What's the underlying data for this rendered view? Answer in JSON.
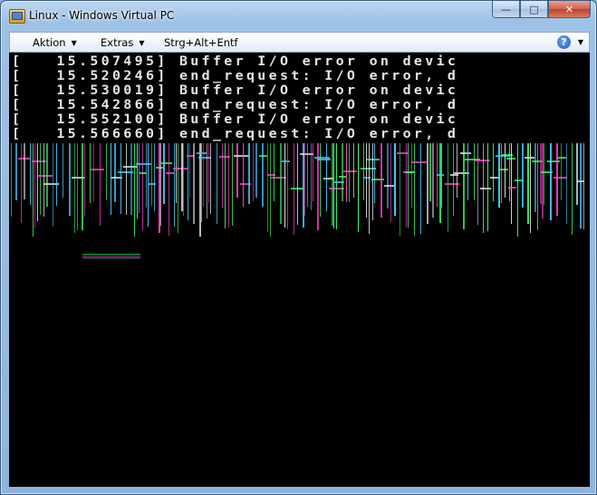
{
  "window": {
    "title": "Linux - Windows Virtual PC",
    "caption_min": "—",
    "caption_max": "□",
    "caption_close": "✕"
  },
  "menubar": {
    "items": [
      {
        "label": "Aktion",
        "has_dropdown": true
      },
      {
        "label": "Extras",
        "has_dropdown": true
      },
      {
        "label": "Strg+Alt+Entf",
        "has_dropdown": false
      }
    ],
    "dropdown_arrow": "▼",
    "help_icon": "question-mark-icon",
    "help_label": "?"
  },
  "console": {
    "lines": [
      "[   15.507495] Buffer I/O error on devic",
      "[   15.520246] end_request: I/O error, d",
      "[   15.530019] Buffer I/O error on devic",
      "[   15.542866] end_request: I/O error, d",
      "[   15.552100] Buffer I/O error on devic",
      "[   15.566660] end_request: I/O error, d"
    ],
    "text_color": "#e6e6e6",
    "background": "#000000"
  },
  "colors": {
    "glitch_green": "#33ff66",
    "glitch_magenta": "#ff44cc",
    "glitch_cyan": "#44ccff",
    "glitch_white": "#e6e6e6"
  }
}
